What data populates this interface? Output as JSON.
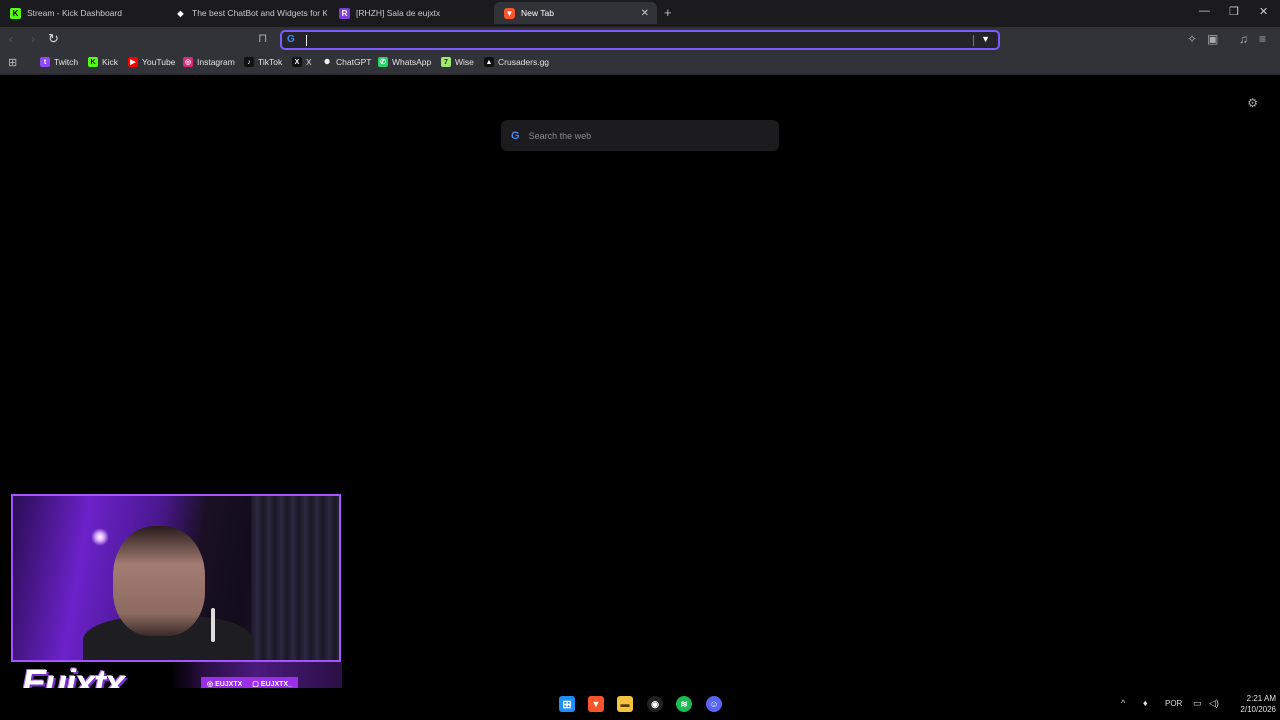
{
  "tabs": [
    {
      "title": "Stream - Kick Dashboard",
      "icon": "kick-icon",
      "active": false
    },
    {
      "title": "The best ChatBot and Widgets for Ki",
      "icon": "botrix-icon",
      "active": false
    },
    {
      "title": "[RHZH] Sala de eujxtx",
      "icon": "rhzh-icon",
      "active": false
    },
    {
      "title": "New Tab",
      "icon": "brave-icon",
      "active": true
    }
  ],
  "omnibox": {
    "value": ""
  },
  "bookmarks": [
    {
      "label": "Twitch",
      "icon": "twitch-icon"
    },
    {
      "label": "Kick",
      "icon": "kick-icon"
    },
    {
      "label": "YouTube",
      "icon": "youtube-icon"
    },
    {
      "label": "Instagram",
      "icon": "instagram-icon"
    },
    {
      "label": "TikTok",
      "icon": "tiktok-icon"
    },
    {
      "label": "X",
      "icon": "x-icon"
    },
    {
      "label": "ChatGPT",
      "icon": "chatgpt-icon"
    },
    {
      "label": "WhatsApp",
      "icon": "whatsapp-icon"
    },
    {
      "label": "Wise",
      "icon": "wise-icon"
    },
    {
      "label": "Crusaders.gg",
      "icon": "crusaders-icon"
    }
  ],
  "newtab": {
    "search_placeholder": "Search the web"
  },
  "overlay": {
    "brand": "Eujxtx",
    "social_1": "EUJXTX",
    "social_2": "EUJXTX_"
  },
  "taskbar": {
    "language": "POR",
    "time": "2:21 AM",
    "date": "2/10/2026"
  },
  "colors": {
    "accent": "#7c5cff",
    "brand_purple": "#9b2fe8"
  }
}
